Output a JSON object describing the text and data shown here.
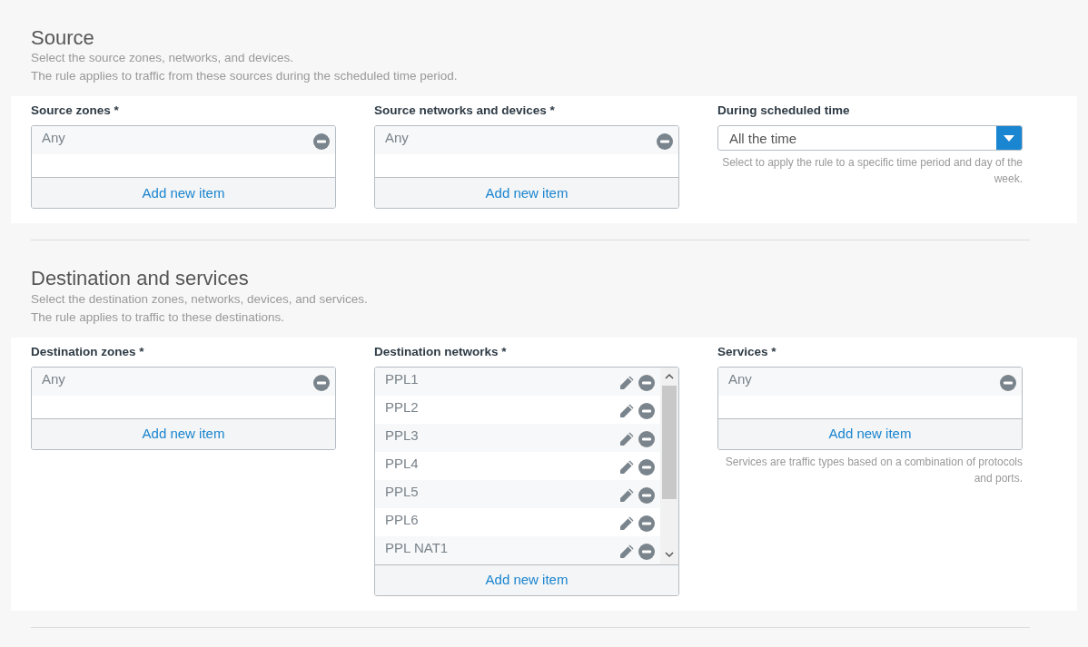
{
  "sections": [
    {
      "title": "Source",
      "description": [
        "Select the source zones, networks, and devices.",
        "The rule applies to traffic from these sources during the scheduled time period."
      ],
      "fields": [
        {
          "kind": "list",
          "label": "Source zones *",
          "items": [
            {
              "label": "Any",
              "editable": false
            }
          ],
          "add_label": "Add new item"
        },
        {
          "kind": "list",
          "label": "Source networks and devices *",
          "items": [
            {
              "label": "Any",
              "editable": false
            }
          ],
          "add_label": "Add new item"
        },
        {
          "kind": "select",
          "label": "During scheduled time",
          "value": "All the time",
          "help": "Select to apply the rule to a specific time period and day of the week."
        }
      ]
    },
    {
      "title": "Destination and services",
      "description": [
        "Select the destination zones, networks, devices, and services.",
        "The rule applies to traffic to these destinations."
      ],
      "fields": [
        {
          "kind": "list",
          "label": "Destination zones *",
          "items": [
            {
              "label": "Any",
              "editable": false
            }
          ],
          "add_label": "Add new item"
        },
        {
          "kind": "list",
          "label": "Destination networks *",
          "scrollable": true,
          "items": [
            {
              "label": "PPL1",
              "editable": true
            },
            {
              "label": "PPL2",
              "editable": true
            },
            {
              "label": "PPL3",
              "editable": true
            },
            {
              "label": "PPL4",
              "editable": true
            },
            {
              "label": "PPL5",
              "editable": true
            },
            {
              "label": "PPL6",
              "editable": true
            },
            {
              "label": "PPL NAT1",
              "editable": true
            }
          ],
          "add_label": "Add new item"
        },
        {
          "kind": "list",
          "label": "Services *",
          "items": [
            {
              "label": "Any",
              "editable": false
            }
          ],
          "add_label": "Add new item",
          "help": "Services are traffic types based on a combination of protocols and ports."
        }
      ]
    }
  ]
}
